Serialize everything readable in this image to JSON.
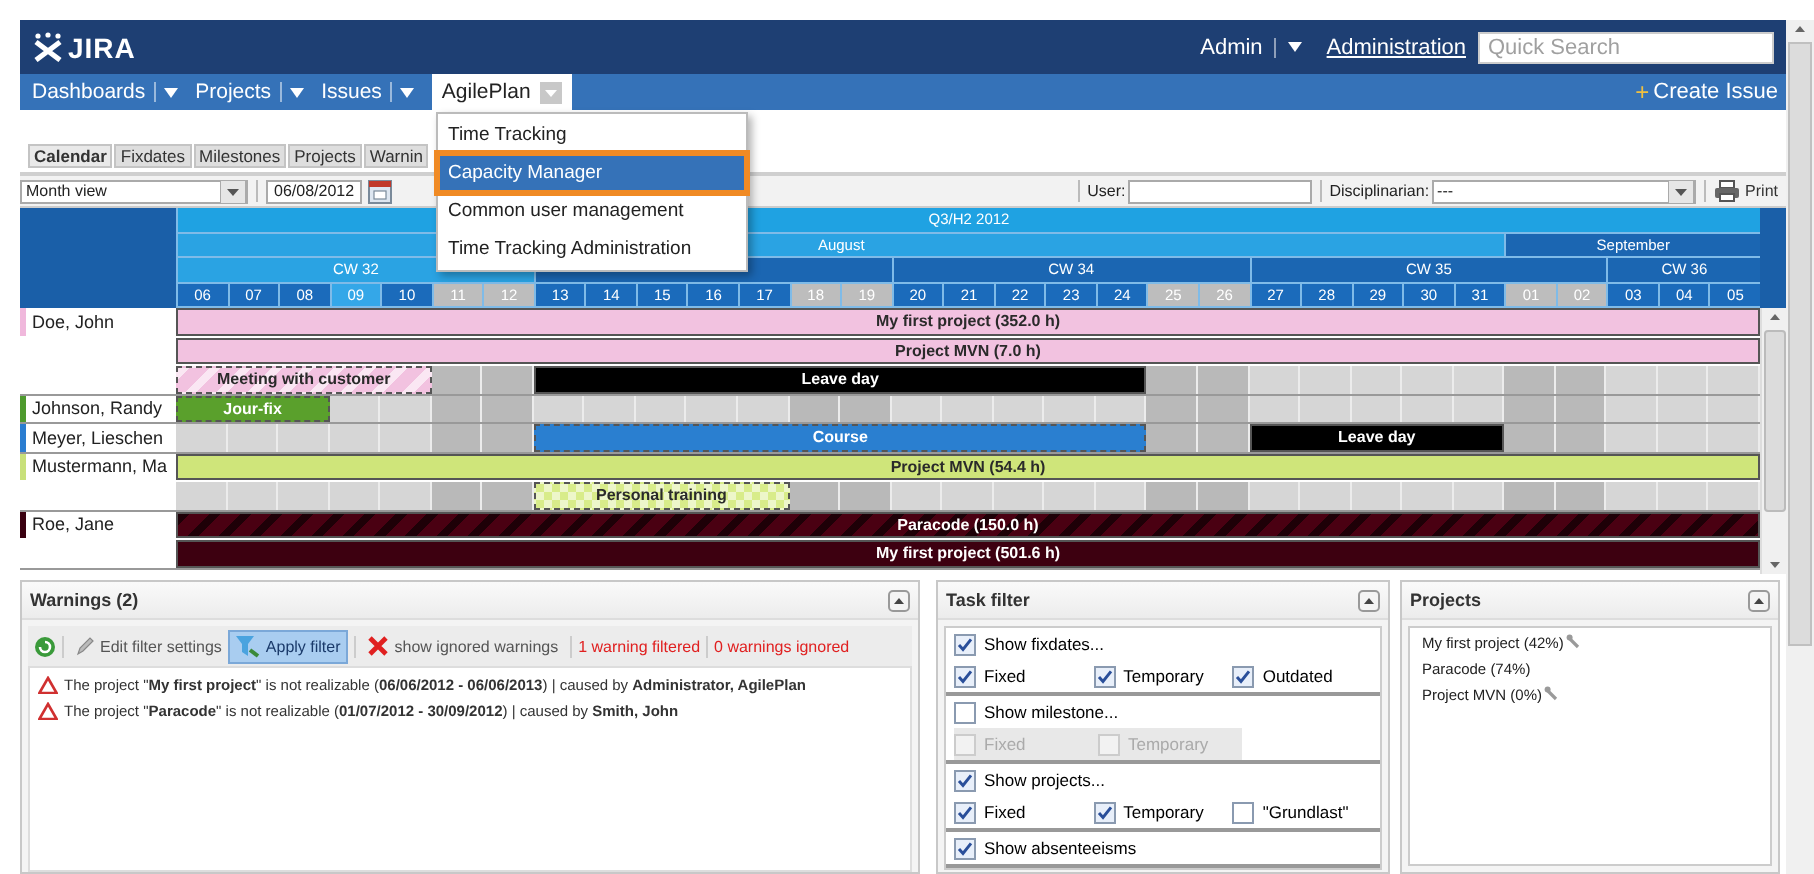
{
  "header": {
    "logo": "JIRA",
    "user_menu": "Admin",
    "admin_link": "Administration",
    "search": {
      "placeholder": "Quick Search"
    }
  },
  "nav": {
    "items": [
      {
        "label": "Dashboards",
        "selected": false
      },
      {
        "label": "Projects",
        "selected": false
      },
      {
        "label": "Issues",
        "selected": false
      },
      {
        "label": "AgilePlan",
        "selected": true
      }
    ],
    "create_icon": "+",
    "create": "Create Issue"
  },
  "menu": {
    "items": [
      {
        "label": "Time Tracking",
        "selected": false
      },
      {
        "label": "Capacity Manager",
        "selected": true
      },
      {
        "label": "Common user management",
        "selected": false
      },
      {
        "label": "Time Tracking Administration",
        "selected": false
      }
    ]
  },
  "tabs": [
    {
      "label": "Calendar",
      "selected": true
    },
    {
      "label": "Fixdates",
      "selected": false
    },
    {
      "label": "Milestones",
      "selected": false
    },
    {
      "label": "Projects",
      "selected": false
    },
    {
      "label": "Warnin",
      "selected": false
    }
  ],
  "toolbar": {
    "view": "Month view",
    "date": "06/08/2012",
    "user_label": "User:",
    "disciplinarian_label": "Disciplinarian:",
    "disciplinarian_value": "---",
    "print": "Print"
  },
  "calendar": {
    "quarter": "Q3/H2 2012",
    "months": [
      {
        "label": "August",
        "current": true
      },
      {
        "label": "September",
        "current": false
      }
    ],
    "weeks": [
      {
        "label": "CW 32",
        "current": true,
        "days": [
          {
            "label": "06",
            "weekend": false,
            "today": false
          },
          {
            "label": "07",
            "weekend": false,
            "today": false
          },
          {
            "label": "08",
            "weekend": false,
            "today": false
          },
          {
            "label": "09",
            "weekend": false,
            "today": true
          },
          {
            "label": "10",
            "weekend": false,
            "today": false
          },
          {
            "label": "11",
            "weekend": true,
            "today": false
          },
          {
            "label": "12",
            "weekend": true,
            "today": false
          }
        ]
      },
      {
        "current": false,
        "days": [
          {
            "label": "13",
            "weekend": false,
            "today": false
          },
          {
            "label": "14",
            "weekend": false,
            "today": false
          },
          {
            "label": "15",
            "weekend": false,
            "today": false
          },
          {
            "label": "16",
            "weekend": false,
            "today": false
          },
          {
            "label": "17",
            "weekend": false,
            "today": false
          },
          {
            "label": "18",
            "weekend": true,
            "today": false
          },
          {
            "label": "19",
            "weekend": true,
            "today": false
          }
        ]
      },
      {
        "label": "CW 34",
        "current": false,
        "days": [
          {
            "label": "20",
            "weekend": false,
            "today": false
          },
          {
            "label": "21",
            "weekend": false,
            "today": false
          },
          {
            "label": "22",
            "weekend": false,
            "today": false
          },
          {
            "label": "23",
            "weekend": false,
            "today": false
          },
          {
            "label": "24",
            "weekend": false,
            "today": false
          },
          {
            "label": "25",
            "weekend": true,
            "today": false
          },
          {
            "label": "26",
            "weekend": true,
            "today": false
          }
        ]
      },
      {
        "label": "CW 35",
        "current": false,
        "days": [
          {
            "label": "27",
            "weekend": false,
            "today": false
          },
          {
            "label": "28",
            "weekend": false,
            "today": false
          },
          {
            "label": "29",
            "weekend": false,
            "today": false
          },
          {
            "label": "30",
            "weekend": false,
            "today": false
          },
          {
            "label": "31",
            "weekend": false,
            "today": false
          },
          {
            "label": "01",
            "weekend": true,
            "today": false
          },
          {
            "label": "02",
            "weekend": true,
            "today": false
          }
        ]
      },
      {
        "label": "CW 36",
        "current": false,
        "days": [
          {
            "label": "03",
            "weekend": false,
            "today": false
          },
          {
            "label": "04",
            "weekend": false,
            "today": false
          },
          {
            "label": "05",
            "weekend": false,
            "today": false
          }
        ]
      }
    ],
    "rows": [
      {
        "name": "Doe, John",
        "color": "#f0b8dc",
        "lanes": [
          {
            "cells": [
              {
                "kind": "solid",
                "label": "My first project (352.0 h)",
                "color": "#f2c2e0",
                "dashed": false
              },
              {
                "kind": "more"
              },
              {
                "kind": "more"
              },
              {
                "kind": "more"
              },
              {
                "kind": "more"
              },
              {
                "kind": "more"
              },
              {
                "kind": "more"
              },
              {
                "kind": "more"
              },
              {
                "kind": "more"
              },
              {
                "kind": "more"
              },
              {
                "kind": "more"
              },
              {
                "kind": "more"
              },
              {
                "kind": "more"
              },
              {
                "kind": "more"
              },
              {
                "kind": "more"
              },
              {
                "kind": "more"
              },
              {
                "kind": "more"
              },
              {
                "kind": "more"
              },
              {
                "kind": "more"
              },
              {
                "kind": "more"
              },
              {
                "kind": "more"
              },
              {
                "kind": "more"
              },
              {
                "kind": "more"
              },
              {
                "kind": "more"
              },
              {
                "kind": "more"
              },
              {
                "kind": "more"
              },
              {
                "kind": "more"
              },
              {
                "kind": "more"
              },
              {
                "kind": "more"
              },
              {
                "kind": "more"
              },
              {
                "kind": "more"
              }
            ]
          },
          {
            "cells": [
              {
                "kind": "solid",
                "label": "Project MVN (7.0 h)",
                "color": "#f2c2e0",
                "dashed": false
              },
              {
                "kind": "more"
              },
              {
                "kind": "more"
              },
              {
                "kind": "more"
              },
              {
                "kind": "more"
              },
              {
                "kind": "more"
              },
              {
                "kind": "more"
              },
              {
                "kind": "more"
              },
              {
                "kind": "more"
              },
              {
                "kind": "more"
              },
              {
                "kind": "more"
              },
              {
                "kind": "more"
              },
              {
                "kind": "more"
              },
              {
                "kind": "more"
              },
              {
                "kind": "more"
              },
              {
                "kind": "more"
              },
              {
                "kind": "more"
              },
              {
                "kind": "more"
              },
              {
                "kind": "more"
              },
              {
                "kind": "more"
              },
              {
                "kind": "more"
              },
              {
                "kind": "more"
              },
              {
                "kind": "more"
              },
              {
                "kind": "more"
              },
              {
                "kind": "more"
              },
              {
                "kind": "more"
              },
              {
                "kind": "more"
              },
              {
                "kind": "more"
              },
              {
                "kind": "more"
              },
              {
                "kind": "more"
              },
              {
                "kind": "more"
              }
            ]
          },
          {
            "cells": [
              {
                "kind": "hatched",
                "label": "Meeting with customer",
                "color": "#f2c2e0",
                "dashed": true
              },
              {
                "kind": "more"
              },
              {
                "kind": "more"
              },
              {
                "kind": "more"
              },
              {
                "kind": "more"
              },
              {
                "kind": "free"
              },
              {
                "kind": "free"
              },
              {
                "kind": "solid",
                "label": "Leave day",
                "color": "#000000",
                "dashed": false
              },
              {
                "kind": "more"
              },
              {
                "kind": "more"
              },
              {
                "kind": "more"
              },
              {
                "kind": "more"
              },
              {
                "kind": "more"
              },
              {
                "kind": "more"
              },
              {
                "kind": "more"
              },
              {
                "kind": "more"
              },
              {
                "kind": "more"
              },
              {
                "kind": "more"
              },
              {
                "kind": "more"
              },
              {
                "kind": "free"
              },
              {
                "kind": "free"
              },
              {
                "kind": "free"
              },
              {
                "kind": "free"
              },
              {
                "kind": "free"
              },
              {
                "kind": "free"
              },
              {
                "kind": "free"
              },
              {
                "kind": "free"
              },
              {
                "kind": "free"
              },
              {
                "kind": "free"
              },
              {
                "kind": "free"
              },
              {
                "kind": "free"
              }
            ]
          }
        ]
      },
      {
        "name": "Johnson, Randy",
        "color": "#4e9a2e",
        "lanes": [
          {
            "cells": [
              {
                "kind": "solid",
                "label": "Jour-fix",
                "color": "#5aa02c",
                "dashed": true
              },
              {
                "kind": "more"
              },
              {
                "kind": "more"
              },
              {
                "kind": "free"
              },
              {
                "kind": "free"
              },
              {
                "kind": "free"
              },
              {
                "kind": "free"
              },
              {
                "kind": "free"
              },
              {
                "kind": "free"
              },
              {
                "kind": "free"
              },
              {
                "kind": "free"
              },
              {
                "kind": "free"
              },
              {
                "kind": "free"
              },
              {
                "kind": "free"
              },
              {
                "kind": "free"
              },
              {
                "kind": "free"
              },
              {
                "kind": "free"
              },
              {
                "kind": "free"
              },
              {
                "kind": "free"
              },
              {
                "kind": "free"
              },
              {
                "kind": "free"
              },
              {
                "kind": "free"
              },
              {
                "kind": "free"
              },
              {
                "kind": "free"
              },
              {
                "kind": "free"
              },
              {
                "kind": "free"
              },
              {
                "kind": "free"
              },
              {
                "kind": "free"
              },
              {
                "kind": "free"
              },
              {
                "kind": "free"
              },
              {
                "kind": "free"
              }
            ]
          }
        ]
      },
      {
        "name": "Meyer, Lieschen",
        "color": "#2a7dd0",
        "lanes": [
          {
            "cells": [
              {
                "kind": "free"
              },
              {
                "kind": "free"
              },
              {
                "kind": "free"
              },
              {
                "kind": "free"
              },
              {
                "kind": "free"
              },
              {
                "kind": "free"
              },
              {
                "kind": "free"
              },
              {
                "kind": "solid",
                "label": "Course",
                "color": "#2a7fd0",
                "dashed": true
              },
              {
                "kind": "more"
              },
              {
                "kind": "more"
              },
              {
                "kind": "more"
              },
              {
                "kind": "more"
              },
              {
                "kind": "more"
              },
              {
                "kind": "more"
              },
              {
                "kind": "more"
              },
              {
                "kind": "more"
              },
              {
                "kind": "more"
              },
              {
                "kind": "more"
              },
              {
                "kind": "more"
              },
              {
                "kind": "free"
              },
              {
                "kind": "free"
              },
              {
                "kind": "solid",
                "label": "Leave day",
                "color": "#000000",
                "dashed": false
              },
              {
                "kind": "more"
              },
              {
                "kind": "more"
              },
              {
                "kind": "more"
              },
              {
                "kind": "more"
              },
              {
                "kind": "free"
              },
              {
                "kind": "free"
              },
              {
                "kind": "free"
              },
              {
                "kind": "free"
              },
              {
                "kind": "free"
              }
            ]
          }
        ]
      },
      {
        "name": "Mustermann, Ma",
        "color": "#c8e07a",
        "lanes": [
          {
            "cells": [
              {
                "kind": "solid",
                "label": "Project MVN (54.4 h)",
                "color": "#cfe57a",
                "dashed": false
              },
              {
                "kind": "more"
              },
              {
                "kind": "more"
              },
              {
                "kind": "more"
              },
              {
                "kind": "more"
              },
              {
                "kind": "more"
              },
              {
                "kind": "more"
              },
              {
                "kind": "more"
              },
              {
                "kind": "more"
              },
              {
                "kind": "more"
              },
              {
                "kind": "more"
              },
              {
                "kind": "more"
              },
              {
                "kind": "more"
              },
              {
                "kind": "more"
              },
              {
                "kind": "more"
              },
              {
                "kind": "more"
              },
              {
                "kind": "more"
              },
              {
                "kind": "more"
              },
              {
                "kind": "more"
              },
              {
                "kind": "more"
              },
              {
                "kind": "more"
              },
              {
                "kind": "more"
              },
              {
                "kind": "more"
              },
              {
                "kind": "more"
              },
              {
                "kind": "more"
              },
              {
                "kind": "more"
              },
              {
                "kind": "more"
              },
              {
                "kind": "more"
              },
              {
                "kind": "more"
              },
              {
                "kind": "more"
              },
              {
                "kind": "more"
              }
            ]
          },
          {
            "cells": [
              {
                "kind": "free"
              },
              {
                "kind": "free"
              },
              {
                "kind": "free"
              },
              {
                "kind": "free"
              },
              {
                "kind": "free"
              },
              {
                "kind": "free"
              },
              {
                "kind": "free"
              },
              {
                "kind": "checkered",
                "label": "Personal training",
                "color": "#d8ec8a",
                "dashed": true
              },
              {
                "kind": "more"
              },
              {
                "kind": "more"
              },
              {
                "kind": "more"
              },
              {
                "kind": "more"
              },
              {
                "kind": "free"
              },
              {
                "kind": "free"
              },
              {
                "kind": "free"
              },
              {
                "kind": "free"
              },
              {
                "kind": "free"
              },
              {
                "kind": "free"
              },
              {
                "kind": "free"
              },
              {
                "kind": "free"
              },
              {
                "kind": "free"
              },
              {
                "kind": "free"
              },
              {
                "kind": "free"
              },
              {
                "kind": "free"
              },
              {
                "kind": "free"
              },
              {
                "kind": "free"
              },
              {
                "kind": "free"
              },
              {
                "kind": "free"
              },
              {
                "kind": "free"
              },
              {
                "kind": "free"
              },
              {
                "kind": "free"
              }
            ]
          }
        ]
      },
      {
        "name": "Roe, Jane",
        "color": "#3a0010",
        "lanes": [
          {
            "cells": [
              {
                "kind": "hatched",
                "label": "Paracode (150.0 h)",
                "color": "#4a0012",
                "dashed": false
              },
              {
                "kind": "more"
              },
              {
                "kind": "more"
              },
              {
                "kind": "more"
              },
              {
                "kind": "more"
              },
              {
                "kind": "more"
              },
              {
                "kind": "more"
              },
              {
                "kind": "more"
              },
              {
                "kind": "more"
              },
              {
                "kind": "more"
              },
              {
                "kind": "more"
              },
              {
                "kind": "more"
              },
              {
                "kind": "more"
              },
              {
                "kind": "more"
              },
              {
                "kind": "more"
              },
              {
                "kind": "more"
              },
              {
                "kind": "more"
              },
              {
                "kind": "more"
              },
              {
                "kind": "more"
              },
              {
                "kind": "more"
              },
              {
                "kind": "more"
              },
              {
                "kind": "more"
              },
              {
                "kind": "more"
              },
              {
                "kind": "more"
              },
              {
                "kind": "more"
              },
              {
                "kind": "more"
              },
              {
                "kind": "more"
              },
              {
                "kind": "more"
              },
              {
                "kind": "more"
              },
              {
                "kind": "more"
              },
              {
                "kind": "more"
              }
            ]
          },
          {
            "cells": [
              {
                "kind": "solid",
                "label": "My first project (501.6 h)",
                "color": "#3d0010",
                "dashed": false
              },
              {
                "kind": "more"
              },
              {
                "kind": "more"
              },
              {
                "kind": "more"
              },
              {
                "kind": "more"
              },
              {
                "kind": "more"
              },
              {
                "kind": "more"
              },
              {
                "kind": "more"
              },
              {
                "kind": "more"
              },
              {
                "kind": "more"
              },
              {
                "kind": "more"
              },
              {
                "kind": "more"
              },
              {
                "kind": "more"
              },
              {
                "kind": "more"
              },
              {
                "kind": "more"
              },
              {
                "kind": "more"
              },
              {
                "kind": "more"
              },
              {
                "kind": "more"
              },
              {
                "kind": "more"
              },
              {
                "kind": "more"
              },
              {
                "kind": "more"
              },
              {
                "kind": "more"
              },
              {
                "kind": "more"
              },
              {
                "kind": "more"
              },
              {
                "kind": "more"
              },
              {
                "kind": "more"
              },
              {
                "kind": "more"
              },
              {
                "kind": "more"
              },
              {
                "kind": "more"
              },
              {
                "kind": "more"
              },
              {
                "kind": "more"
              }
            ]
          }
        ]
      }
    ]
  },
  "warnings": {
    "title": "Warnings (2)",
    "edit": "Edit filter settings",
    "apply": {
      "label": "Apply filter",
      "selected": true
    },
    "show_ignored": "show ignored warnings",
    "filtered": "1 warning filtered",
    "ignored": "0 warnings ignored",
    "messages": [
      "The project \"**My first project**\" is not realizable (**06/06/2012 - 06/06/2013**) | caused by **Administrator, AgilePlan**",
      "The project \"**Paracode**\" is not realizable (**01/07/2012 - 30/09/2012**) | caused by **Smith, John**"
    ]
  },
  "task_filter": {
    "title": "Task filter",
    "groups": [
      {
        "label": "Show fixdates...",
        "checked": true,
        "options": [
          {
            "label": "Fixed",
            "checked": true,
            "disabled": false
          },
          {
            "label": "Temporary",
            "checked": true,
            "disabled": false
          },
          {
            "label": "Outdated",
            "checked": true,
            "disabled": false
          }
        ]
      },
      {
        "label": "Show milestone...",
        "checked": false,
        "options": [
          {
            "label": "Fixed",
            "checked": false,
            "disabled": true
          },
          {
            "label": "Temporary",
            "checked": false,
            "disabled": true
          }
        ]
      },
      {
        "label": "Show projects...",
        "checked": true,
        "options": [
          {
            "label": "Fixed",
            "checked": true,
            "disabled": false
          },
          {
            "label": "Temporary",
            "checked": true,
            "disabled": false
          },
          {
            "label": "\"Grundlast\"",
            "checked": false,
            "disabled": false
          }
        ]
      },
      {
        "label": "Show absenteeisms",
        "checked": true
      }
    ]
  },
  "projects": {
    "title": "Projects",
    "items": [
      {
        "label": "My first project (42%)",
        "tool_icon": true
      },
      {
        "label": "Paracode (74%)",
        "tool_icon": false
      },
      {
        "label": "Project MVN (0%)",
        "tool_icon": true
      }
    ]
  }
}
